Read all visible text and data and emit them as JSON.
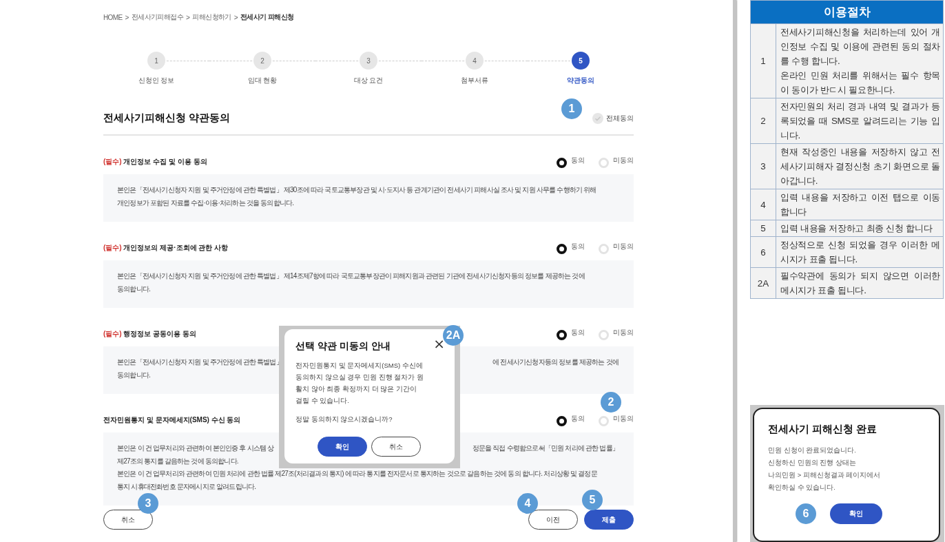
{
  "breadcrumb": [
    {
      "label": "HOME",
      "current": false
    },
    {
      "label": "전세사기피해접수",
      "current": false
    },
    {
      "label": "피해신청하기",
      "current": false
    },
    {
      "label": "전세사기 피해신청",
      "current": true
    }
  ],
  "breadcrumb_separator": ">",
  "steps": [
    {
      "number": "1",
      "label": "신청인 정보",
      "selected": false
    },
    {
      "number": "2",
      "label": "임대 현황",
      "selected": false
    },
    {
      "number": "3",
      "label": "대상 요건",
      "selected": false
    },
    {
      "number": "4",
      "label": "첨부서류",
      "selected": false
    },
    {
      "number": "5",
      "label": "약관동의",
      "selected": true
    }
  ],
  "title": "전세사기피해신청 약관동의",
  "agree_all": {
    "label": "전체동의",
    "checked": false,
    "badge": "1"
  },
  "sections": [
    {
      "required_tag": "(필수)",
      "title": "개인정보 수집 및 이용 동의",
      "options": [
        {
          "label": "동의",
          "selected": true
        },
        {
          "label": "미동의",
          "selected": false
        }
      ],
      "lines": [
        {
          "text": "본인은「전세사기신청자 지원 및 주거안정에 관한 특별법」 제30조에 따라 국토교통부장관 및 시·도지사 등 관계기관이 전세사기 피해사실 조사 및 지원 사무를 수행하기 위해"
        },
        {
          "text": "개인정보가 포함된 자료를 수집·이용·처리하는 것을 동의합니다."
        }
      ]
    },
    {
      "required_tag": "(필수)",
      "title": "개인정보의 제공·조회에 관한 사항",
      "options": [
        {
          "label": "동의",
          "selected": true
        },
        {
          "label": "미동의",
          "selected": false
        }
      ],
      "lines": [
        {
          "text": "본인은「전세사기신청자 지원 및 주거안정에 관한 특별법」 제14조제7항에 따라 국토교통부장관이 피해지원과 관련된 기관에 전세사기신청자등의 정보를 제공하는 것에"
        },
        {
          "text": "동의합니다."
        }
      ]
    },
    {
      "required_tag": "(필수)",
      "title": "행정정보 공동이용 동의",
      "options": [
        {
          "label": "동의",
          "selected": true
        },
        {
          "label": "미동의",
          "selected": false
        }
      ],
      "lines": [
        {
          "text": "본인은「전세사기신청자 지원 및 주거안정에 관한 특별법」",
          "text_right": "에 전세사기신청자등의 정보를 제공하는 것에"
        },
        {
          "text": "동의합니다."
        }
      ]
    },
    {
      "title": "전자민원통지 및 문자메세지(SMS) 수신 동의",
      "options": [
        {
          "label": "동의",
          "selected": true
        },
        {
          "label": "미동의",
          "selected": false,
          "badge": "2"
        }
      ],
      "lines": [
        {
          "text": "본인은 이 건 업무처리와 관련하여 본인인증 후 시스템 상",
          "text_right": "정문을 직접 수령함으로써「민원 처리에 관한 법률」"
        },
        {
          "text": "제27조의 통지를 갈음하는 것에 동의합니다."
        },
        {
          "text": "본인은 이 건 업무처리와 관련하여 민원 처리에 관한 법률 제27조(처리결과의 통지) 에 따라 통지를 전자문서로 통지하는 것으로 갈음하는 것에 동의 합니다. 처리상황 및 결정문"
        },
        {
          "text": "통지 시휴대전화번호 문자메시지로 알려드립니다."
        }
      ]
    }
  ],
  "buttons": [
    {
      "kind": "outline",
      "label": "취소",
      "badge": "3"
    },
    {
      "kind": "outline",
      "label": "이전",
      "badge": "4"
    },
    {
      "kind": "primary",
      "label": "제출",
      "badge": "5"
    }
  ],
  "modal": {
    "title": "선택 약관 미동의 안내",
    "close": "×",
    "badge": "2A",
    "paragraphs": [
      "전자민원통지 및 문자메세지(SMS) 수신에 동의하지 않으실 경우 민원 진행 절차가 원활치 않아 최종 확정까지 더 많은 기간이 걸릴 수 있습니다.",
      "정말 동의하지 않으시겠습니까?"
    ],
    "buttons": [
      {
        "kind": "primary",
        "label": "확인"
      },
      {
        "kind": "outline",
        "label": "취소"
      }
    ]
  },
  "procedure_table": {
    "title": "이용절차",
    "rows": [
      {
        "number": "1",
        "paragraphs": [
          "전세사기피해신청을 처리하는데 있어 개인정보 수집 및 이용에 관련된 동의 절차를 수행 합니다.",
          "온라인 민원 처리를 위해서는 필수 항목이 동이가 반ㄷ시 필요한니다."
        ]
      },
      {
        "number": "2",
        "paragraphs": [
          "전자민원의 처리 경과 내역 및 결과가 등록되었을 때 SMS로 알려드리는 기능 입니다."
        ]
      },
      {
        "number": "3",
        "paragraphs": [
          "현재 작성중인 내용을 저장하지 않고 전세사기피해자 결정신청 초기 화면으로 돌아갑니다."
        ]
      },
      {
        "number": "4",
        "paragraphs": [
          "입력 내용을 저장하고 이전 탭으로 이동 합니다"
        ]
      },
      {
        "number": "5",
        "paragraphs": [
          "입력 내용을 저장하고 최종 신청 합니다"
        ]
      },
      {
        "number": "6",
        "paragraphs": [
          "정상적으로 신청 되었을 경우 이러한 메시지가 표출 됩니다."
        ]
      },
      {
        "number": "2A",
        "paragraphs": [
          "필수약관에 동의가 되지 않으면 이러한 메시지가 표출 됩니다."
        ]
      }
    ]
  },
  "done_dialog": {
    "title": "전세사기 피해신청 완료",
    "lines": [
      "민원 신청이 완료되었습니다.",
      "신청하신 민원의 진행 상태는",
      "나의민원 > 피해신청결과 페이지에서",
      "확인하실 수 있습니다."
    ],
    "badge": "6",
    "button": "확인"
  }
}
